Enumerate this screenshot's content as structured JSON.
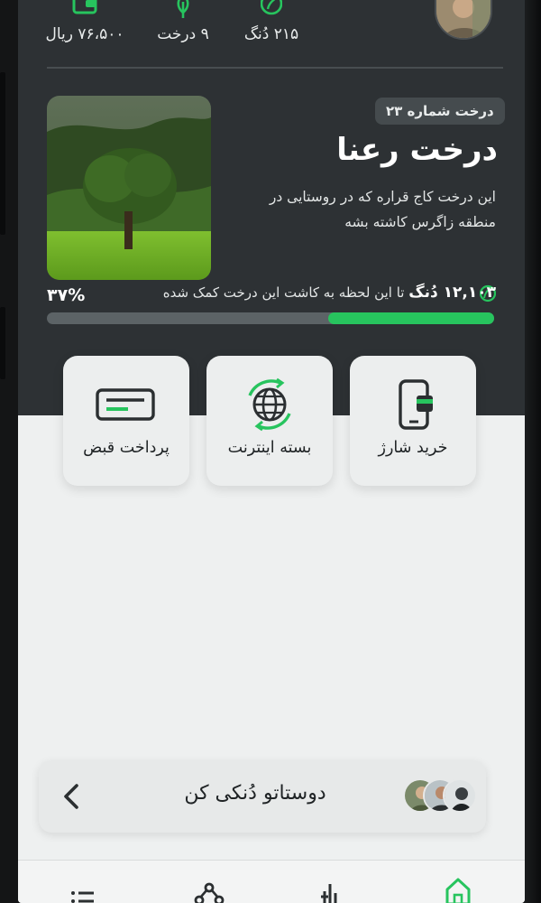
{
  "stats": {
    "wallet": "۷۶،۵۰۰ ریال",
    "trees": "۹ درخت",
    "dong": "۲۱۵ دُنگ"
  },
  "tree": {
    "badge": "درخت شماره ۲۳",
    "name": "درخت رعنا",
    "description": "این درخت کاج قراره که در روستایی در منطقه زاگرس کاشته بشه",
    "contribution_amount": "۱۲,۱۰۳ دُنگ",
    "contribution_text": "تا این لحظه به کاشت این درخت کمک شده",
    "percent_label": "۳۷%",
    "progress": 0.37
  },
  "services": [
    {
      "label": "خرید شارژ",
      "icon": "phone-card-icon"
    },
    {
      "label": "بسته اینترنت",
      "icon": "globe-refresh-icon"
    },
    {
      "label": "پرداخت قبض",
      "icon": "bill-card-icon"
    }
  ],
  "invite": {
    "label": "دوستاتو دُنکی کن",
    "chevron": "chevron-left-icon"
  },
  "nav": {
    "items": [
      "home-icon",
      "tree-icon",
      "network-icon",
      "list-icon"
    ]
  },
  "colors": {
    "header_bg": "#2d3134",
    "accent_green": "#27c45e",
    "surface": "#eef0f0"
  }
}
